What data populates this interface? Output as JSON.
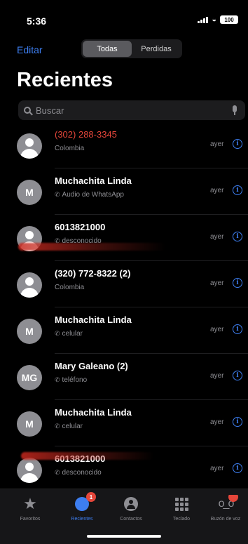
{
  "status_bar": {
    "time": "5:36",
    "battery": "100"
  },
  "header": {
    "edit_label": "Editar",
    "segments": [
      {
        "label": "Todas",
        "active": true
      },
      {
        "label": "Perdidas",
        "active": false
      }
    ],
    "title": "Recientes"
  },
  "search": {
    "placeholder": "Buscar"
  },
  "calls": [
    {
      "name": "(302) 288-3345",
      "subtitle": "Colombia",
      "date": "ayer",
      "missed": true,
      "avatar": "silhouette"
    },
    {
      "name": "Muchachita Linda",
      "subtitle": "Audio de WhatsApp",
      "date": "ayer",
      "missed": false,
      "avatar": "M"
    },
    {
      "name": "6013821000",
      "subtitle": "desconocido",
      "date": "ayer",
      "missed": false,
      "avatar": "silhouette"
    },
    {
      "name": "(320) 772-8322 (2)",
      "subtitle": "Colombia",
      "date": "ayer",
      "missed": false,
      "avatar": "silhouette"
    },
    {
      "name": "Muchachita Linda",
      "subtitle": "celular",
      "date": "ayer",
      "missed": false,
      "avatar": "M"
    },
    {
      "name": "Mary Galeano (2)",
      "subtitle": "teléfono",
      "date": "ayer",
      "missed": false,
      "avatar": "MG"
    },
    {
      "name": "Muchachita Linda",
      "subtitle": "celular",
      "date": "ayer",
      "missed": false,
      "avatar": "M"
    },
    {
      "name": "6013821000",
      "subtitle": "desconocido",
      "date": "ayer",
      "missed": false,
      "avatar": "silhouette"
    }
  ],
  "tabbar": {
    "tabs": [
      {
        "label": "Favoritos",
        "icon": "star-icon"
      },
      {
        "label": "Recientes",
        "icon": "clock-icon",
        "badge": "1",
        "active": true
      },
      {
        "label": "Contactos",
        "icon": "person-icon"
      },
      {
        "label": "Teclado",
        "icon": "keypad-icon"
      },
      {
        "label": "Buzón de voz",
        "icon": "voicemail-icon"
      }
    ]
  },
  "colors": {
    "accent": "#3d7ef0",
    "missed": "#e4463a",
    "background": "#000000"
  }
}
